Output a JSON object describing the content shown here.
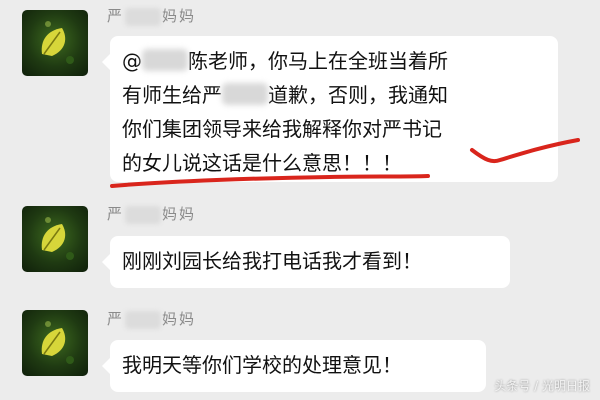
{
  "colors": {
    "background": "#ececec",
    "bubble": "#ffffff",
    "sender_text": "#8a8a8a",
    "underline_red": "#d9251c"
  },
  "messages": [
    {
      "sender_prefix": "严",
      "sender_suffix": "妈妈",
      "avatar_icon": "leaf-avatar-icon",
      "lines": [
        {
          "pre": "@",
          "post": "陈老师，你马上在全班当着所"
        },
        {
          "pre": "有师生给严",
          "post": "道歉，否则，我通知"
        },
        {
          "pre": "",
          "post": "你们集团领导来给我解释你对严书记"
        },
        {
          "pre": "",
          "post": "的女儿说这话是什么意思！！！"
        }
      ]
    },
    {
      "sender_prefix": "严",
      "sender_suffix": "妈妈",
      "avatar_icon": "leaf-avatar-icon",
      "text": "刚刚刘园长给我打电话我才看到！"
    },
    {
      "sender_prefix": "严",
      "sender_suffix": "妈妈",
      "avatar_icon": "leaf-avatar-icon",
      "text": "我明天等你们学校的处理意见！"
    }
  ],
  "watermark": "头条号 / 光明日报"
}
